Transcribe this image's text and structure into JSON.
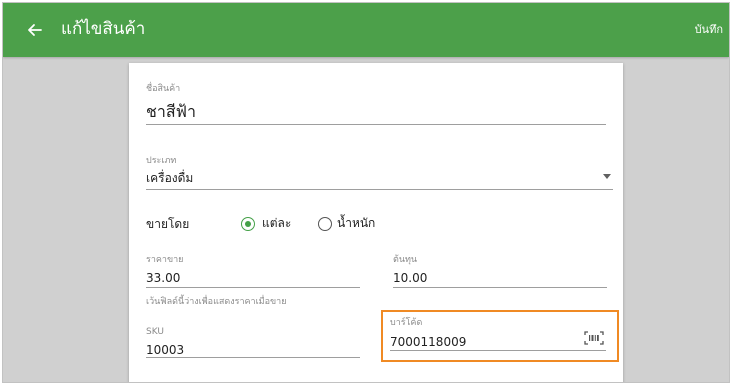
{
  "appbar": {
    "title": "แก้ไขสินค้า",
    "save_label": "บันทึก",
    "color": "#4ca04a"
  },
  "form": {
    "product_name": {
      "label": "ชื่อสินค้า",
      "value": "ชาสีฟ้า"
    },
    "category": {
      "label": "ประเภท",
      "value": "เครื่องดื่ม"
    },
    "sell_by": {
      "label": "ขายโดย",
      "options": [
        {
          "label": "แต่ละ",
          "selected": true
        },
        {
          "label": "น้ำหนัก",
          "selected": false
        }
      ]
    },
    "price": {
      "label": "ราคาขาย",
      "value": "33.00",
      "hint": "เว้นฟิลด์นี้ว่างเพื่อแสดงราคาเมื่อขาย"
    },
    "cost": {
      "label": "ต้นทุน",
      "value": "10.00"
    },
    "sku": {
      "label": "SKU",
      "value": "10003"
    },
    "barcode": {
      "label": "บาร์โค้ด",
      "value": "7000118009",
      "highlight_color": "#f08a24"
    }
  }
}
